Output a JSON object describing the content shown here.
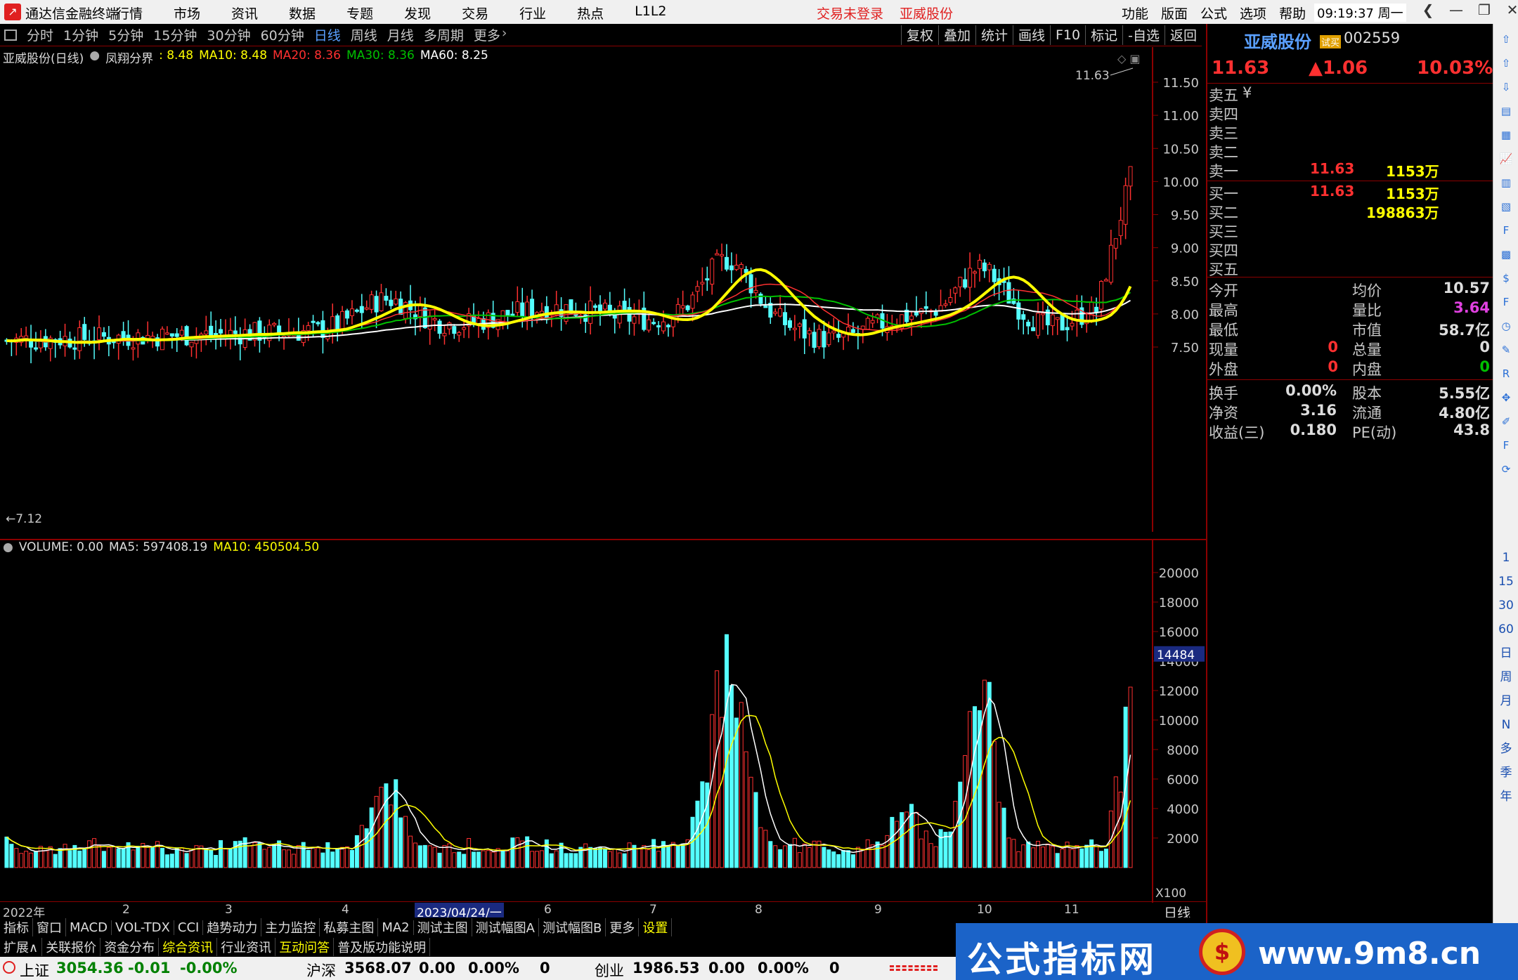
{
  "titlebar": {
    "app_name": "通达信金融终端",
    "menus": [
      "行情",
      "市场",
      "资讯",
      "数据",
      "专题",
      "发现",
      "交易",
      "行业",
      "热点",
      "L1L2"
    ],
    "trade_status": "交易未登录",
    "stock_name": "亚威股份",
    "right_menus": [
      "功能",
      "版面",
      "公式",
      "选项",
      "帮助"
    ],
    "clock": "09:19:37 周一"
  },
  "toolbar": {
    "periods": [
      "分时",
      "1分钟",
      "5分钟",
      "15分钟",
      "30分钟",
      "60分钟",
      "日线",
      "周线",
      "月线",
      "多周期",
      "更多"
    ],
    "active_period": "日线",
    "buttons": [
      "复权",
      "叠加",
      "统计",
      "画线",
      "F10",
      "标记",
      "-自选",
      "返回"
    ]
  },
  "kline": {
    "title": "亚威股份(日线)",
    "indicator_name": "凤翔分界",
    "ma5_label": ": 8.48",
    "ma10_label": "MA10: 8.48",
    "ma20_label": "MA20: 8.36",
    "ma30_label": "MA30: 8.36",
    "ma60_label": "MA60: 8.25",
    "high_marker": "11.63",
    "low_marker": "←7.12",
    "y_ticks": [
      "11.50",
      "11.00",
      "10.50",
      "10.00",
      "9.50",
      "9.00",
      "8.50",
      "8.00",
      "7.50"
    ]
  },
  "volume": {
    "label": "VOLUME: 0.00",
    "ma5": "MA5: 597408.19",
    "ma10": "MA10: 450504.50",
    "y_ticks": [
      "20000",
      "18000",
      "16000",
      "14000",
      "12000",
      "10000",
      "8000",
      "6000",
      "4000",
      "2000"
    ],
    "highlight_value": "14484",
    "unit": "X100"
  },
  "x_axis": {
    "labels": [
      "2022年",
      "2",
      "3",
      "4",
      "2023/04/24/一",
      "6",
      "7",
      "8",
      "9",
      "10",
      "11"
    ],
    "period_tag": "日线"
  },
  "quote": {
    "name": "亚威股份",
    "tag": "试买",
    "code": "002559",
    "price": "11.63",
    "change": "▲1.06",
    "pct": "10.03%",
    "sell_labels": [
      "卖五",
      "卖四",
      "卖三",
      "卖二",
      "卖一"
    ],
    "sell5_unit": "¥",
    "sell1_price": "11.63",
    "sell1_vol": "1153万",
    "buy_labels": [
      "买一",
      "买二",
      "买三",
      "买四",
      "买五"
    ],
    "buy1_price": "11.63",
    "buy1_vol": "1153万",
    "buy2_vol": "198863万",
    "stats": [
      [
        "今开",
        "",
        "均价",
        "10.57"
      ],
      [
        "最高",
        "",
        "量比",
        "3.64"
      ],
      [
        "最低",
        "",
        "市值",
        "58.7亿"
      ],
      [
        "现量",
        "0",
        "总量",
        "0"
      ],
      [
        "外盘",
        "0",
        "内盘",
        "0"
      ]
    ],
    "stats2": [
      [
        "换手",
        "0.00%",
        "股本",
        "5.55亿"
      ],
      [
        "净资",
        "3.16",
        "流通",
        "4.80亿"
      ],
      [
        "收益(三)",
        "0.180",
        "PE(动)",
        "43.8"
      ]
    ]
  },
  "sidebar": [
    "1",
    "15",
    "30",
    "60",
    "日",
    "周",
    "月",
    "N",
    "多",
    "季",
    "年"
  ],
  "bottom_tabs": [
    "指标",
    "窗口",
    "MACD",
    "VOL-TDX",
    "CCI",
    "趋势动力",
    "主力监控",
    "私募主图",
    "MA2",
    "测试主图",
    "测试幅图A",
    "测试幅图B",
    "更多",
    "设置"
  ],
  "bottom_tabs2": [
    "扩展∧",
    "关联报价",
    "资金分布",
    "综合资讯",
    "行业资讯",
    "互动问答",
    "普及版功能说明"
  ],
  "statusbar": {
    "idx1_name": "上证",
    "idx1_val": "3054.36",
    "idx1_chg": "-0.01",
    "idx1_pct": "-0.00%",
    "idx2_name": "沪深",
    "idx2_val": "3568.07",
    "idx2_chg": "0.00",
    "idx2_pct": "0.00%",
    "idx2_vol": "0",
    "idx3_name": "创业",
    "idx3_val": "1986.53",
    "idx3_chg": "0.00",
    "idx3_pct": "0.00%",
    "idx3_vol": "0"
  },
  "ad": {
    "text": "公式指标网",
    "url": "www.9m8.cn"
  },
  "colors": {
    "up": "#ff3030",
    "down": "#54ffff",
    "ma5": "#ffff00",
    "ma20": "#ff3030",
    "ma30": "#00c000",
    "ma60": "#ffffff",
    "accent_blue": "#5aa0ff"
  }
}
